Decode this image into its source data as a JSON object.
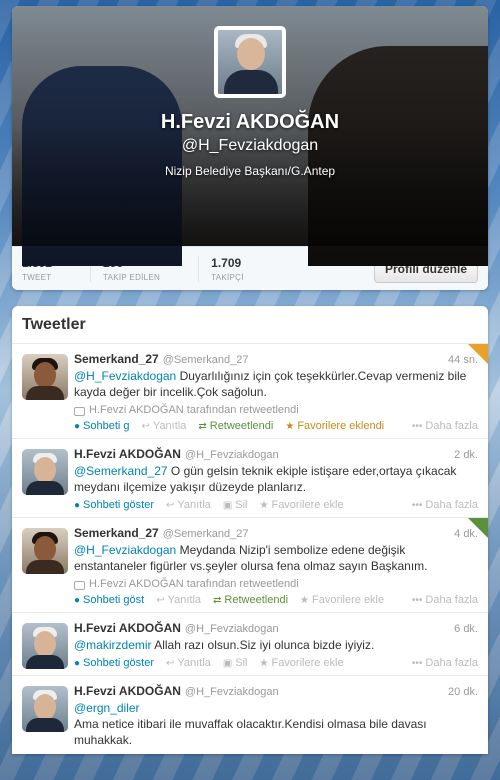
{
  "profile": {
    "name": "H.Fevzi AKDOĞAN",
    "handle": "@H_Fevziakdogan",
    "bio": "Nizip Belediye Başkanı/G.Antep",
    "stats": [
      {
        "value": "1.892",
        "label": "TWEET"
      },
      {
        "value": "296",
        "label": "TAKİP EDİLEN"
      },
      {
        "value": "1.709",
        "label": "TAKİPÇİ"
      }
    ],
    "edit_button": "Profili düzenle"
  },
  "timeline": {
    "title": "Tweetler",
    "tweets": [
      {
        "name": "Semerkand_27",
        "handle": "@Semerkand_27",
        "time": "44 sn.",
        "mention": "@H_Fevziakdogan",
        "text": " Duyarlılığınız için çok teşekkürler.Cevap vermeniz bile kayda değer bir incelik.Çok sağolun.",
        "retweet_note": "H.Fevzi AKDOĞAN tarafından retweetlendi",
        "conversation": "Sohbeti g",
        "reply": "Yanıtla",
        "retweet": "Retweetlendi",
        "favorite": "Favorilere eklendi",
        "more": "Daha fazla"
      },
      {
        "name": "H.Fevzi AKDOĞAN",
        "handle": "@H_Fevziakdogan",
        "time": "2 dk.",
        "mention": "@Semerkand_27",
        "text": " O gün gelsin teknik ekiple istişare eder,ortaya çıkacak meydanı ilçemize yakışır düzeyde planlarız.",
        "conversation": "Sohbeti göster",
        "reply": "Yanıtla",
        "delete": "Sil",
        "favorite": "Favorilere ekle",
        "more": "Daha fazla"
      },
      {
        "name": "Semerkand_27",
        "handle": "@Semerkand_27",
        "time": "4 dk.",
        "mention": "@H_Fevziakdogan",
        "text": " Meydanda Nizip'i sembolize edene değişik enstantaneler figürler vs.şeyler olursa fena olmaz sayın Başkanım.",
        "retweet_note": "H.Fevzi AKDOĞAN tarafından retweetlendi",
        "conversation": "Sohbeti göst",
        "reply": "Yanıtla",
        "retweet": "Retweetlendi",
        "favorite": "Favorilere ekle",
        "more": "Daha fazla"
      },
      {
        "name": "H.Fevzi AKDOĞAN",
        "handle": "@H_Fevziakdogan",
        "time": "6 dk.",
        "mention": "@makirzdemir",
        "text": " Allah razı olsun.Siz iyi olunca bizde iyiyiz.",
        "conversation": "Sohbeti göster",
        "reply": "Yanıtla",
        "delete": "Sil",
        "favorite": "Favorilere ekle",
        "more": "Daha fazla"
      },
      {
        "name": "H.Fevzi AKDOĞAN",
        "handle": "@H_Fevziakdogan",
        "time": "20 dk.",
        "mention": "@ergn_diler",
        "text": "Ama netice itibari ile muvaffak olacaktır.Kendisi olmasa bile davası muhakkak."
      }
    ]
  },
  "colors": {
    "link": "#0084b4",
    "retweet_green": "#5c913b",
    "favorite_orange": "#cc8a18"
  },
  "icons": [
    "reply-icon",
    "retweet-icon",
    "favorite-star-icon",
    "delete-trash-icon",
    "more-dots-icon",
    "conversation-icon"
  ]
}
